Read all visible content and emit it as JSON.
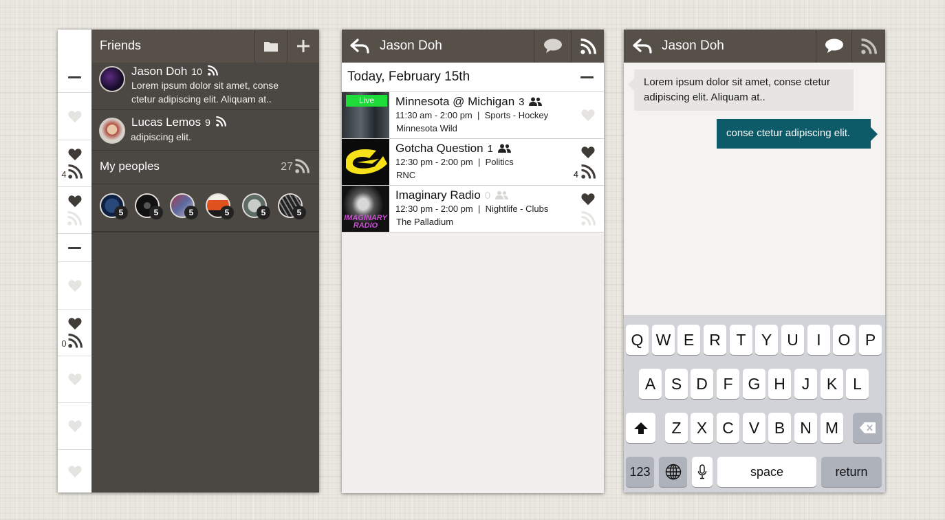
{
  "colors": {
    "header_bg": "#565049",
    "accent_teal": "#0a5b68",
    "panel_dark": "#4b4742",
    "live_green": "#1ddc3a"
  },
  "friends_screen": {
    "title": "Friends",
    "icons": {
      "app": "heart-icon",
      "folder": "folder-icon",
      "add": "plus-icon"
    },
    "rail": [
      {
        "type": "collapse"
      },
      {
        "type": "heart-empty"
      },
      {
        "type": "heart-rss",
        "count": "4"
      },
      {
        "type": "heart-rss-faded"
      },
      {
        "type": "collapse"
      },
      {
        "type": "heart-empty"
      },
      {
        "type": "heart-rss",
        "count": "0"
      },
      {
        "type": "heart-empty"
      },
      {
        "type": "heart-empty"
      },
      {
        "type": "heart-empty"
      }
    ],
    "friends": [
      {
        "name": "Jason Doh",
        "count": "10",
        "text": "Lorem ipsum dolor sit amet, conse ctetur adipiscing elit. Aliquam at.."
      },
      {
        "name": "Lucas Lemos",
        "count": "9",
        "text": "adipiscing elit."
      }
    ],
    "my_peoples": {
      "label": "My peoples",
      "count": "27",
      "items": [
        "5",
        "5",
        "5",
        "5",
        "5",
        "5"
      ]
    }
  },
  "schedule_screen": {
    "title": "Jason Doh",
    "date_label": "Today, February 15th",
    "events": [
      {
        "title": "Minnesota @ Michigan",
        "people": "3",
        "time": "11:30 am - 2:00 pm",
        "category": "Sports - Hockey",
        "place": "Minnesota Wild",
        "live": "Live",
        "liked": false,
        "rss_count": ""
      },
      {
        "title": "Gotcha Question",
        "people": "1",
        "time": "12:30 pm - 2:00 pm",
        "category": "Politics",
        "place": "RNC",
        "live": "",
        "liked": true,
        "rss_count": "4"
      },
      {
        "title": "Imaginary Radio",
        "people": "0",
        "time": "12:30 pm - 2:00 pm",
        "category": "Nightlife - Clubs",
        "place": "The Palladium",
        "live": "",
        "liked": true,
        "rss_count": "",
        "thumb_text": "IMAGINARY RADIO"
      }
    ],
    "separator": "|"
  },
  "chat_screen": {
    "title": "Jason Doh",
    "messages": [
      {
        "from": "them",
        "text": "Lorem ipsum dolor sit amet, conse ctetur adipiscing elit. Aliquam at.."
      },
      {
        "from": "me",
        "text": "conse ctetur adipiscing elit."
      }
    ],
    "keyboard": {
      "row1": [
        "Q",
        "W",
        "E",
        "R",
        "T",
        "Y",
        "U",
        "I",
        "O",
        "P"
      ],
      "row2": [
        "A",
        "S",
        "D",
        "F",
        "G",
        "H",
        "J",
        "K",
        "L"
      ],
      "row3": [
        "Z",
        "X",
        "C",
        "V",
        "B",
        "N",
        "M"
      ],
      "numbers": "123",
      "space": "space",
      "return": "return"
    }
  }
}
